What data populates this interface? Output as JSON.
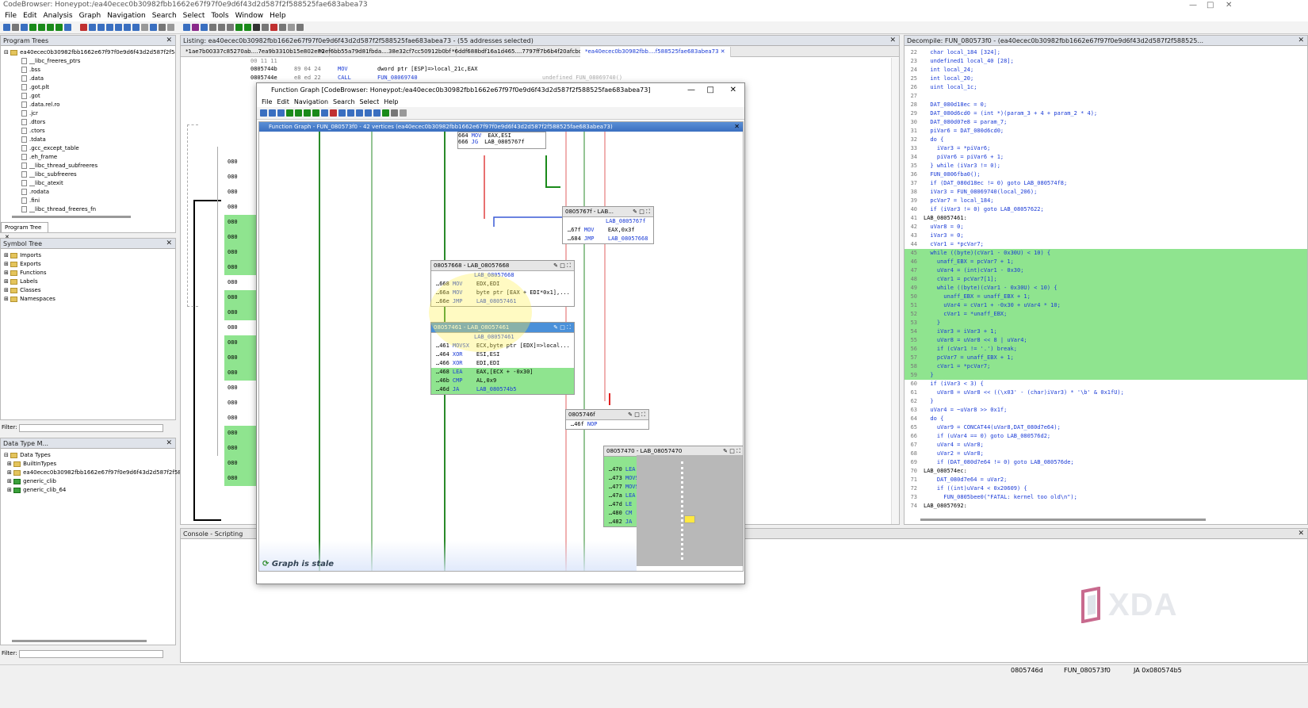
{
  "window": {
    "title": "CodeBrowser: Honeypot:/ea40ecec0b30982fbb1662e67f97f0e9d6f43d2d587f2f588525fae683abea73"
  },
  "menu": [
    "File",
    "Edit",
    "Analysis",
    "Graph",
    "Navigation",
    "Search",
    "Select",
    "Tools",
    "Window",
    "Help"
  ],
  "program_trees": {
    "title": "Program Trees",
    "root": "ea40ecec0b30982fbb1662e67f97f0e9d6f43d2d587f2f58852",
    "items": [
      "__libc_freeres_ptrs",
      ".bss",
      ".data",
      ".got.plt",
      ".got",
      ".data.rel.ro",
      ".jcr",
      ".dtors",
      ".ctors",
      ".tdata",
      ".gcc_except_table",
      ".eh_frame",
      "__libc_thread_subfreeres",
      "__libc_subfreeres",
      "__libc_atexit",
      ".rodata",
      ".fini",
      "__libc_thread_freeres_fn"
    ],
    "tab": "Program Tree"
  },
  "symbol_tree": {
    "title": "Symbol Tree",
    "items": [
      "Imports",
      "Exports",
      "Functions",
      "Labels",
      "Classes",
      "Namespaces"
    ]
  },
  "filter_label": "Filter:",
  "data_types": {
    "title": "Data Type M...",
    "items": [
      "Data Types",
      "BuiltInTypes",
      "ea40ecec0b30982fbb1662e67f97f0e9d6f43d2d587f2f588525fae6",
      "generic_clib",
      "generic_clib_64"
    ]
  },
  "listing": {
    "title": "Listing:  ea40ecec0b30982fbb1662e67f97f0e9d6f43d2d587f2f588525fae683abea73 - (55 addresses selected)",
    "tabs": [
      "*1ae7b00337c85270ab....7ea9b3310b15e802e80",
      "*2ef6bb55a79d81fbda....38e32cf7cc50912b0bf",
      "*6ddf688bdf16a1d465....7797ff7b6b4f20afcbc",
      "*ea40ecec0b30982fbb....f588525fae683abea73"
    ],
    "row0": "00 11 11",
    "row1": {
      "addr": "0805744b",
      "bytes": "89 04 24",
      "mnem": "MOV",
      "ops": "dword ptr [ESP]=>local_21c,EAX"
    },
    "row2": {
      "addr": "0805744e",
      "bytes": "e8 ed 22",
      "mnem": "CALL",
      "ops": "FUN_08069740",
      "cmt": "undefined FUN_08069740()"
    },
    "side_addrs": [
      "080",
      "080",
      "080",
      "080",
      "080",
      "080",
      "080",
      "080",
      "080",
      "080",
      "080",
      "080",
      "080",
      "080",
      "080",
      "080",
      "080",
      "080",
      "080",
      "080",
      "080",
      "080"
    ]
  },
  "function_graph": {
    "window_title": "Function Graph [CodeBrowser: Honeypot:/ea40ecec0b30982fbb1662e67f97f0e9d6f43d2d587f2f588525fae683abea73]",
    "menu": [
      "File",
      "Edit",
      "Navigation",
      "Search",
      "Select",
      "Help"
    ],
    "header": "Function Graph - FUN_080573f0 - 42 vertices  (ea40ecec0b30982fbb1662e67f97f0e9d6f43d2d587f2f588525fae683abea73)",
    "stale": "Graph is stale",
    "top_lines": [
      {
        "a": "664",
        "m": "MOV",
        "o": "EAX,ESI"
      },
      {
        "a": "666",
        "m": "JG",
        "o": "LAB_0805767f"
      }
    ],
    "blocks": [
      {
        "title": "0805767f - LAB...",
        "label": "LAB_0805767f",
        "lines": [
          {
            "a": "67f",
            "m": "MOV",
            "o": "EAX,0x3f"
          },
          {
            "a": "684",
            "m": "JMP",
            "o": "LAB_08057668"
          }
        ]
      },
      {
        "title": "08057668 - LAB_08057668",
        "label": "LAB_08057668",
        "lines": [
          {
            "a": "668",
            "m": "MOV",
            "o": "EDX,EDI"
          },
          {
            "a": "66a",
            "m": "MOV",
            "o": "byte ptr [EAX + EDI*0x1],..."
          },
          {
            "a": "66e",
            "m": "JMP",
            "o": "LAB_08057461"
          }
        ]
      },
      {
        "title": "08057461 - LAB_08057461",
        "label": "LAB_08057461",
        "lines": [
          {
            "a": "461",
            "m": "MOVSX",
            "o": "ECX,byte ptr [EDX]=>local..."
          },
          {
            "a": "464",
            "m": "XOR",
            "o": "ESI,ESI"
          },
          {
            "a": "466",
            "m": "XOR",
            "o": "EDI,EDI"
          },
          {
            "a": "468",
            "m": "LEA",
            "o": "EAX,[ECX + -0x30]"
          },
          {
            "a": "46b",
            "m": "CMP",
            "o": "AL,0x9"
          },
          {
            "a": "46d",
            "m": "JA",
            "o": "LAB_080574b5"
          }
        ]
      },
      {
        "title": "0805746f",
        "label": "",
        "lines": [
          {
            "a": "46f",
            "m": "NOP",
            "o": ""
          }
        ]
      },
      {
        "title": "08057470 - LAB_08057470",
        "label": "LAB_08057470",
        "lines": [
          {
            "a": "470",
            "m": "LEA",
            "o": "EBX=>local_183,[EDX + 0x1]"
          },
          {
            "a": "473",
            "m": "MOVSX",
            "o": "EDX,byte ptr [EDX + local..."
          },
          {
            "a": "477",
            "m": "MOVSX",
            "o": "EAX,CL"
          },
          {
            "a": "47a",
            "m": "LEA",
            "o": "ECX,[EAX + -0x30]"
          },
          {
            "a": "47d",
            "m": "LE",
            "o": ""
          },
          {
            "a": "480",
            "m": "CM",
            "o": ""
          },
          {
            "a": "482",
            "m": "JA",
            "o": ""
          }
        ]
      }
    ]
  },
  "decompile": {
    "title": "Decompile: FUN_080573f0 - (ea40ecec0b30982fbb1662e67f97f0e9d6f43d2d587f2f588525...",
    "lines": [
      {
        "n": "22",
        "t": "  char local_184 [324];",
        "g": false
      },
      {
        "n": "23",
        "t": "  undefined1 local_40 [28];",
        "g": false
      },
      {
        "n": "24",
        "t": "  int local_24;",
        "g": false
      },
      {
        "n": "25",
        "t": "  int local_20;",
        "g": false
      },
      {
        "n": "26",
        "t": "  uint local_1c;",
        "g": false
      },
      {
        "n": "27",
        "t": "",
        "g": false
      },
      {
        "n": "28",
        "t": "  DAT_080d18ec = 0;",
        "g": false
      },
      {
        "n": "29",
        "t": "  DAT_080d6cd0 = (int *)(param_3 + 4 + param_2 * 4);",
        "g": false
      },
      {
        "n": "30",
        "t": "  DAT_080d07e8 = param_7;",
        "g": false
      },
      {
        "n": "31",
        "t": "  piVar6 = DAT_080d6cd0;",
        "g": false
      },
      {
        "n": "32",
        "t": "  do {",
        "g": false
      },
      {
        "n": "33",
        "t": "    iVar3 = *piVar6;",
        "g": false
      },
      {
        "n": "34",
        "t": "    piVar6 = piVar6 + 1;",
        "g": false
      },
      {
        "n": "35",
        "t": "  } while (iVar3 != 0);",
        "g": false
      },
      {
        "n": "36",
        "t": "  FUN_0806fba0();",
        "g": false
      },
      {
        "n": "37",
        "t": "  if (DAT_080d18ec != 0) goto LAB_080574f8;",
        "g": false
      },
      {
        "n": "38",
        "t": "  iVar3 = FUN_08069740(local_206);",
        "g": false
      },
      {
        "n": "39",
        "t": "  pcVar7 = local_184;",
        "g": false
      },
      {
        "n": "40",
        "t": "  if (iVar3 != 0) goto LAB_08057622;",
        "g": false
      },
      {
        "n": "41",
        "t": "LAB_08057461:",
        "g": false
      },
      {
        "n": "42",
        "t": "  uVar8 = 0;",
        "g": false
      },
      {
        "n": "43",
        "t": "  iVar3 = 0;",
        "g": false
      },
      {
        "n": "44",
        "t": "  cVar1 = *pcVar7;",
        "g": false
      },
      {
        "n": "45",
        "t": "  while ((byte)(cVar1 - 0x30U) < 10) {",
        "g": true
      },
      {
        "n": "46",
        "t": "    unaff_EBX = pcVar7 + 1;",
        "g": true
      },
      {
        "n": "47",
        "t": "    uVar4 = (int)cVar1 - 0x30;",
        "g": true
      },
      {
        "n": "48",
        "t": "    cVar1 = pcVar7[1];",
        "g": true
      },
      {
        "n": "49",
        "t": "    while ((byte)(cVar1 - 0x30U) < 10) {",
        "g": true
      },
      {
        "n": "50",
        "t": "      unaff_EBX = unaff_EBX + 1;",
        "g": true
      },
      {
        "n": "51",
        "t": "      uVar4 = cVar1 + -0x30 + uVar4 * 10;",
        "g": true
      },
      {
        "n": "52",
        "t": "      cVar1 = *unaff_EBX;",
        "g": true
      },
      {
        "n": "53",
        "t": "    }",
        "g": true
      },
      {
        "n": "54",
        "t": "    iVar3 = iVar3 + 1;",
        "g": true
      },
      {
        "n": "55",
        "t": "    uVar8 = uVar8 << 8 | uVar4;",
        "g": true
      },
      {
        "n": "56",
        "t": "    if (cVar1 != '.') break;",
        "g": true
      },
      {
        "n": "57",
        "t": "    pcVar7 = unaff_EBX + 1;",
        "g": true
      },
      {
        "n": "58",
        "t": "    cVar1 = *pcVar7;",
        "g": true
      },
      {
        "n": "59",
        "t": "  }",
        "g": true
      },
      {
        "n": "60",
        "t": "  if (iVar3 < 3) {",
        "g": false
      },
      {
        "n": "61",
        "t": "    uVar8 = uVar8 << ((\\x03' - (char)iVar3) * '\\b' & 0x1fU);",
        "g": false
      },
      {
        "n": "62",
        "t": "  }",
        "g": false
      },
      {
        "n": "63",
        "t": "  uVar4 = ~uVar8 >> 0x1f;",
        "g": false
      },
      {
        "n": "64",
        "t": "  do {",
        "g": false
      },
      {
        "n": "65",
        "t": "    uVar9 = CONCAT44(uVar8,DAT_080d7e64);",
        "g": false
      },
      {
        "n": "66",
        "t": "    if (uVar4 == 0) goto LAB_080576d2;",
        "g": false
      },
      {
        "n": "67",
        "t": "    uVar4 = uVar8;",
        "g": false
      },
      {
        "n": "68",
        "t": "    uVar2 = uVar8;",
        "g": false
      },
      {
        "n": "69",
        "t": "    if (DAT_080d7e64 != 0) goto LAB_080576de;",
        "g": false
      },
      {
        "n": "70",
        "t": "LAB_080574ec:",
        "g": false
      },
      {
        "n": "71",
        "t": "    DAT_080d7e64 = uVar2;",
        "g": false
      },
      {
        "n": "72",
        "t": "    if ((int)uVar4 < 0x20609) {",
        "g": false
      },
      {
        "n": "73",
        "t": "      FUN_0805bee0(\"FATAL: kernel too old\\n\");",
        "g": false
      },
      {
        "n": "74",
        "t": "LAB_08057692:",
        "g": false
      }
    ]
  },
  "console": {
    "title": "Console - Scripting"
  },
  "status": {
    "addr": "0805746d",
    "func": "FUN_080573f0",
    "instr": "JA 0x080574b5"
  },
  "watermark": "XDA"
}
